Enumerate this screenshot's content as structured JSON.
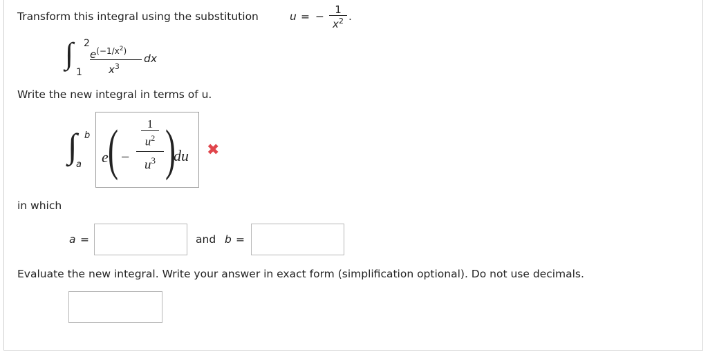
{
  "question": {
    "intro_text": "Transform this integral using the substitution",
    "sub_var": "u",
    "sub_equals": "=",
    "sub_minus": "−",
    "sub_num": "1",
    "sub_den_base": "x",
    "sub_den_exp": "2",
    "sub_period": "."
  },
  "original_integral": {
    "integral_sign": "∫",
    "upper": "2",
    "lower": "1",
    "num_base": "e",
    "num_exp": "(−1/x",
    "num_exp_sup": "2",
    "num_exp_close": ")",
    "den_base": "x",
    "den_exp": "3",
    "dx": "dx"
  },
  "prompt_new_integral": "Write the new integral in terms of u.",
  "entered_answer": {
    "integral_sign": "∫",
    "upper": "b",
    "lower": "a",
    "e": "e",
    "left_paren": "(",
    "minus": "−",
    "inner_num": "1",
    "inner_den_base": "u",
    "inner_den_exp": "2",
    "outer_den_base": "u",
    "outer_den_exp": "3",
    "right_paren": ")",
    "du": "du",
    "status_mark": "✖"
  },
  "in_which_label": "in which",
  "bounds": {
    "a_label": "a",
    "equals": "=",
    "and_label": "and",
    "b_label": "b",
    "a_value": "",
    "b_value": ""
  },
  "evaluate_prompt": "Evaluate the new integral. Write your answer in exact form (simplification optional). Do not use decimals.",
  "final_answer_value": "",
  "colors": {
    "wrong_mark": "#e0454b",
    "box_border": "#b5b5b5"
  }
}
